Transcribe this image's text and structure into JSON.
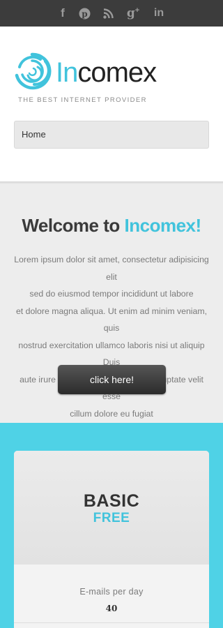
{
  "social": {
    "icons": [
      "facebook-icon",
      "pinterest-icon",
      "rss-icon",
      "google-plus-icon",
      "linkedin-icon"
    ]
  },
  "brand": {
    "name_accent": "In",
    "name_rest": "comex",
    "tagline": "THE BEST INTERNET PROVIDER",
    "accent_color": "#41c3dc"
  },
  "nav": {
    "selected": "Home"
  },
  "welcome": {
    "title_prefix": "Welcome to ",
    "title_accent": "Incomex!",
    "lines": [
      "Lorem ipsum dolor sit amet, consectetur adipisicing elit",
      "sed do eiusmod tempor incididunt ut labore",
      "et dolore magna aliqua. Ut enim ad minim veniam, quis",
      "nostrud exercitation ullamco laboris nisi ut aliquip Duis",
      "aute irure dolor in reprehenderit in voluptate velit esse",
      "cillum dolore eu fugiat"
    ],
    "button_label": "click here!"
  },
  "pricing": {
    "background_color": "#4fd2e6",
    "plan": {
      "name": "BASIC",
      "price": "FREE",
      "feature_label": "E-mails per day",
      "feature_value": "40"
    }
  }
}
